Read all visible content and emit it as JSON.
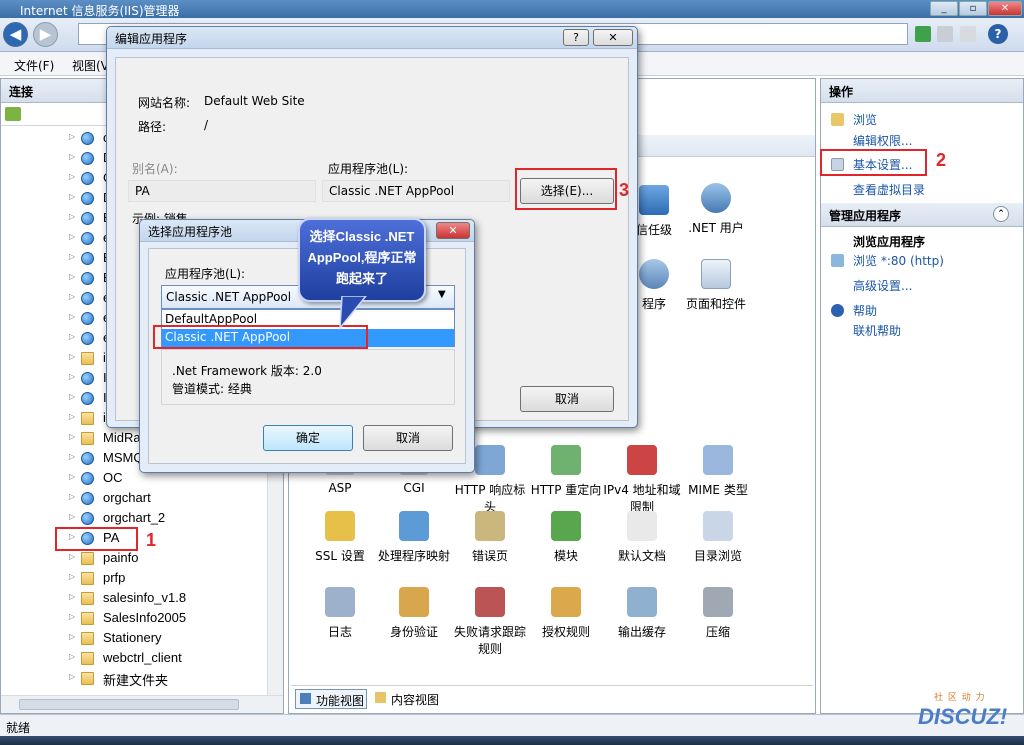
{
  "window": {
    "title": "Internet 信息服务(IIS)管理器"
  },
  "menu": {
    "file": "文件(F)",
    "view": "视图(V"
  },
  "connections": {
    "header": "连接",
    "tree": [
      "c",
      "D",
      "C",
      "D",
      "E",
      "e",
      "E",
      "E",
      "e",
      "e",
      "e",
      "i",
      "I",
      "I",
      "i",
      "MidRa",
      "MSMQ",
      "OC",
      "orgchart",
      "orgchart_2",
      "PA",
      "painfo",
      "prfp",
      "salesinfo_v1.8",
      "SalesInfo2005",
      "Stationery",
      "webctrl_client",
      "新建文件夹"
    ]
  },
  "features": {
    "row0": [
      ".NET 信任级别",
      ".NET 用户"
    ],
    "row0_partial": "信任级",
    "row1_partial": "程序",
    "row1_right": "页面和控件",
    "row2": [
      "ASP",
      "CGI",
      "HTTP 响应标头",
      "HTTP 重定向",
      "IPv4 地址和域限制",
      "MIME 类型"
    ],
    "row3": [
      "SSL 设置",
      "处理程序映射",
      "错误页",
      "模块",
      "默认文档",
      "目录浏览"
    ],
    "row4": [
      "日志",
      "身份验证",
      "失败请求跟踪规则",
      "授权规则",
      "输出缓存",
      "压缩"
    ],
    "tabs": [
      "功能视图",
      "内容视图"
    ]
  },
  "actions": {
    "header": "操作",
    "browse": "浏览",
    "edit_perms": "编辑权限...",
    "basic_settings": "基本设置...",
    "view_vdirs": "查看虚拟目录",
    "manage_header": "管理应用程序",
    "browse_app": "浏览应用程序",
    "browse_port": "浏览 *:80 (http)",
    "advanced": "高级设置...",
    "help": "帮助",
    "online_help": "联机帮助"
  },
  "status": {
    "text": "就绪"
  },
  "edit_dialog": {
    "title": "编辑应用程序",
    "site_label": "网站名称:",
    "site_value": "Default Web Site",
    "path_label": "路径:",
    "path_value": "/",
    "alias_label": "别名(A):",
    "alias_value": "PA",
    "pool_label": "应用程序池(L):",
    "pool_value": "Classic .NET AppPool",
    "select_button": "选择(E)...",
    "example_label": "示例: 销售",
    "cancel": "取消"
  },
  "select_dialog": {
    "title": "选择应用程序池",
    "pool_label": "应用程序池(L):",
    "selected": "Classic .NET AppPool",
    "options": [
      "DefaultAppPool",
      "Classic .NET AppPool"
    ],
    "framework": ".Net Framework 版本: 2.0",
    "pipeline": "管道模式: 经典",
    "ok": "确定",
    "cancel": "取消"
  },
  "annotations": {
    "callout": "选择Classic .NET AppPool,程序正常跑起来了",
    "n1": "1",
    "n2": "2",
    "n3": "3"
  },
  "watermark": "DISCUZ!",
  "watermark_sub": "社 区 动 力"
}
